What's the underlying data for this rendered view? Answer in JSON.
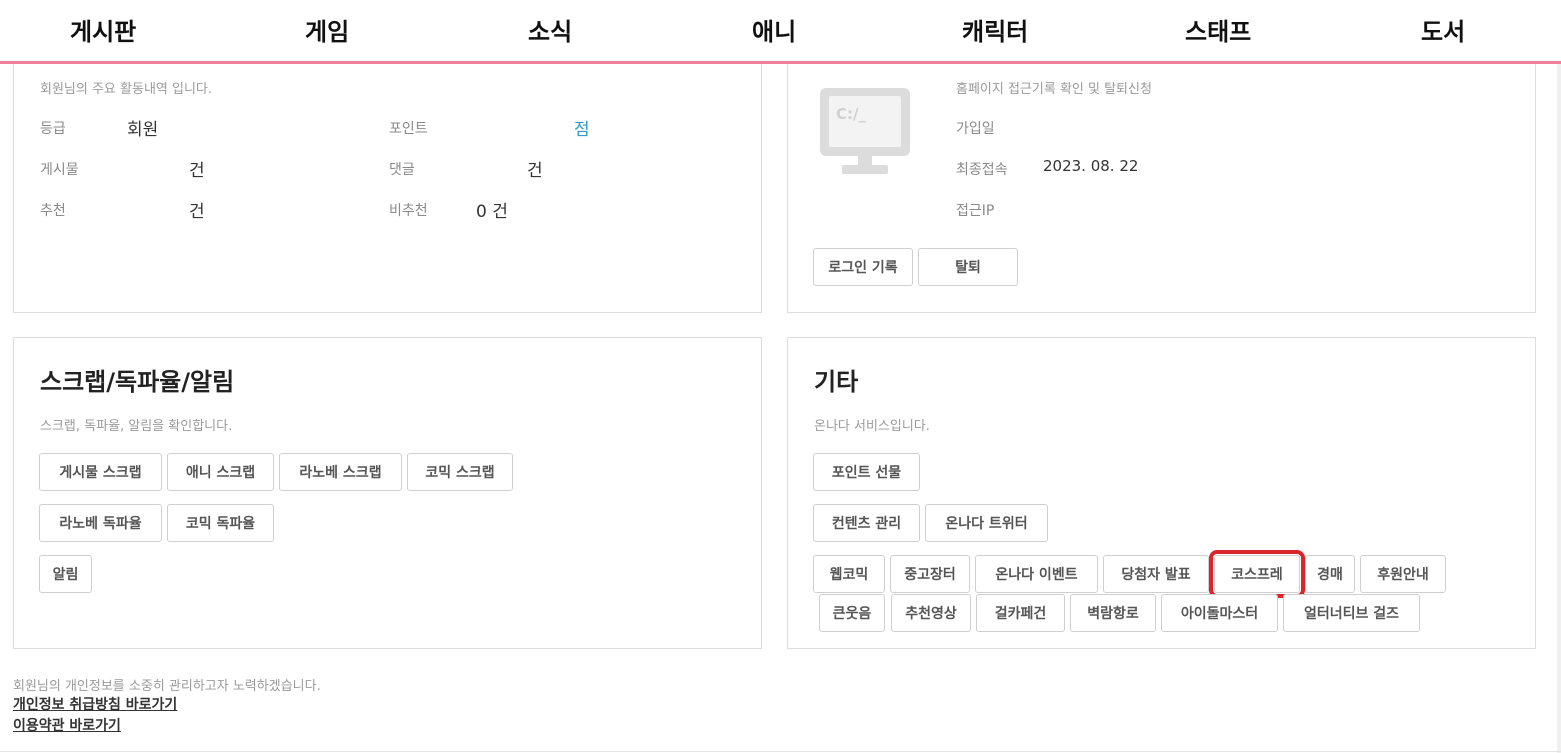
{
  "nav": {
    "items": [
      "게시판",
      "게임",
      "소식",
      "애니",
      "캐릭터",
      "스태프",
      "도서"
    ]
  },
  "activity": {
    "description": "회원님의 주요 활동내역 입니다.",
    "grade_label": "등급",
    "grade_value": "회원",
    "point_label": "포인트",
    "point_value": "점",
    "posts_label": "게시물",
    "posts_value": "건",
    "comments_label": "댓글",
    "comments_value": "건",
    "recommend_label": "추천",
    "recommend_value": "건",
    "nonrecommend_label": "비추천",
    "nonrecommend_value": "0 건"
  },
  "access": {
    "icon": "monitor-icon",
    "icon_text": "C:/_",
    "description": "홈페이지 접근기록 확인 및 탈퇴신청",
    "join_label": "가입일",
    "last_label": "최종접속",
    "last_value": "2023. 08. 22",
    "ip_label": "접근IP",
    "login_history_button": "로그인 기록",
    "withdraw_button": "탈퇴"
  },
  "scrap": {
    "title": "스크랩/독파율/알림",
    "description": "스크랩, 독파율, 알림을 확인합니다.",
    "buttons": [
      "게시물 스크랩",
      "애니 스크랩",
      "라노베 스크랩",
      "코믹 스크랩",
      "라노베 독파율",
      "코믹 독파율",
      "알림"
    ]
  },
  "etc": {
    "title": "기타",
    "description": "온나다 서비스입니다.",
    "buttons": [
      "포인트 선물",
      "컨텐츠 관리",
      "온나다 트위터",
      "웹코믹",
      "중고장터",
      "온나다 이벤트",
      "당첨자 발표",
      "코스프레",
      "경매",
      "후원안내",
      "큰웃음",
      "추천영상",
      "걸카페건",
      "벽람항로",
      "아이돌마스터",
      "얼터너티브 걸즈"
    ]
  },
  "footer": {
    "notice": "회원님의 개인정보를 소중히 관리하고자 노력하겠습니다.",
    "privacy_link": "개인정보 취급방침 바로가기",
    "terms_link": "이용약관 바로가기"
  },
  "colors": {
    "nav_border": "#ee7f99",
    "point_accent": "#2f9bc6",
    "highlight": "#d9262c"
  }
}
